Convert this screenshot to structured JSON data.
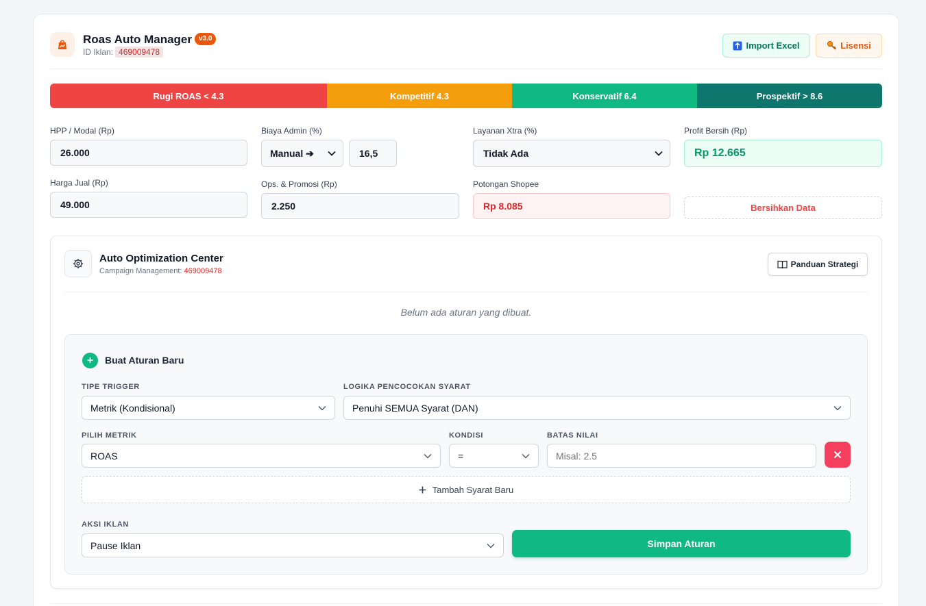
{
  "app": {
    "title": "Roas Auto Manager",
    "version": "v3.0",
    "ad_id_label": "ID Iklan:",
    "ad_id": "469009478"
  },
  "toolbar": {
    "import_label": "Import Excel",
    "license_label": "Lisensi"
  },
  "roas_scale": [
    {
      "label": "Rugi ROAS < 4.3",
      "color": "#ef4444"
    },
    {
      "label": "Kompetitif 4.3",
      "color": "#f59e0b"
    },
    {
      "label": "Konservatif 6.4",
      "color": "#10b981"
    },
    {
      "label": "Prospektif > 8.6",
      "color": "#0f766e"
    }
  ],
  "form": {
    "hpp_label": "HPP / Modal (Rp)",
    "hpp_value": "26.000",
    "harga_label": "Harga Jual (Rp)",
    "harga_value": "49.000",
    "admin_label": "Biaya Admin (%)",
    "admin_mode": "Manual ➔",
    "admin_value": "16,5",
    "promo_label": "Ops. & Promosi (Rp)",
    "promo_value": "2.250",
    "xtra_label": "Layanan Xtra (%)",
    "xtra_value": "Tidak Ada",
    "potongan_label": "Potongan Shopee",
    "potongan_value": "Rp 8.085",
    "profit_label": "Profit Bersih (Rp)",
    "profit_value": "Rp 12.665",
    "clear_label": "Bersihkan Data"
  },
  "optimization": {
    "title": "Auto Optimization Center",
    "subtitle_prefix": "Campaign Management:",
    "campaign_id": "469009478",
    "guide_label": "Panduan Strategi",
    "empty_text": "Belum ada aturan yang dibuat."
  },
  "rule": {
    "title": "Buat Aturan Baru",
    "trigger_label": "TIPE TRIGGER",
    "trigger_value": "Metrik (Kondisional)",
    "logic_label": "LOGIKA PENCOCOKAN SYARAT",
    "logic_value": "Penuhi SEMUA Syarat (DAN)",
    "metric_label": "PILIH METRIK",
    "metric_value": "ROAS",
    "condition_label": "KONDISI",
    "condition_value": "=",
    "limit_label": "BATAS NILAI",
    "limit_placeholder": "Misal: 2.5",
    "add_condition_label": "Tambah Syarat Baru",
    "action_label": "AKSI IKLAN",
    "action_value": "Pause Iklan",
    "save_label": "Simpan Aturan"
  }
}
